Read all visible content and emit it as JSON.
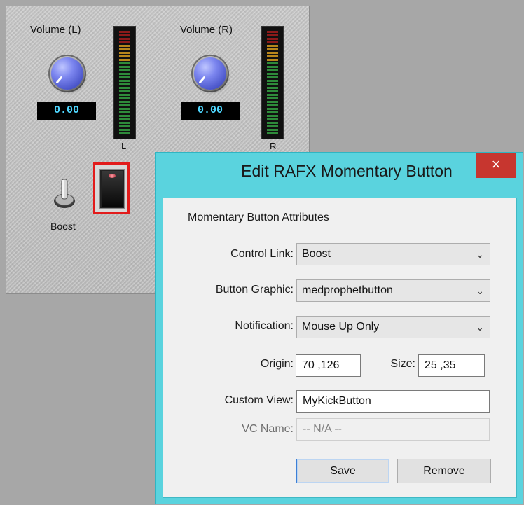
{
  "plugin": {
    "volume_left": {
      "label": "Volume (L)",
      "value": "0.00",
      "meter_label": "L"
    },
    "volume_right": {
      "label": "Volume (R)",
      "value": "0.00",
      "meter_label": "R"
    },
    "boost": {
      "label": "Boost"
    }
  },
  "dialog": {
    "title": "Edit RAFX Momentary Button",
    "close_symbol": "×",
    "section_title": "Momentary Button Attributes",
    "control_link": {
      "label": "Control Link:",
      "value": "Boost"
    },
    "button_graphic": {
      "label": "Button Graphic:",
      "value": "medprophetbutton"
    },
    "notification": {
      "label": "Notification:",
      "value": "Mouse Up Only"
    },
    "origin": {
      "label": "Origin:",
      "value": "70 ,126"
    },
    "size": {
      "label": "Size:",
      "value": "25 ,35"
    },
    "custom_view": {
      "label": "Custom View:",
      "value": "MyKickButton"
    },
    "vc_name": {
      "label": "VC Name:",
      "value": "-- N/A --"
    },
    "save_label": "Save",
    "remove_label": "Remove",
    "chevron_glyph": "❯"
  },
  "colors": {
    "title_bar": "#5ad3de",
    "close": "#c7362f",
    "readout": "#4fd7ff",
    "highlight": "#e21b1b"
  }
}
